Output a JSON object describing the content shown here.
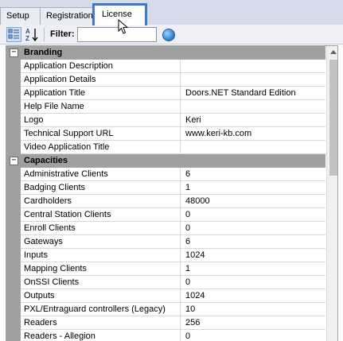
{
  "tabs": [
    {
      "label": "Setup"
    },
    {
      "label": "Registration"
    },
    {
      "label": "License"
    }
  ],
  "active_tab": "License",
  "toolbar": {
    "filter_label": "Filter:",
    "filter_value": ""
  },
  "grid": {
    "categories": [
      {
        "label": "Branding",
        "toggle": "−",
        "rows": [
          {
            "name": "Application Description",
            "value": ""
          },
          {
            "name": "Application Details",
            "value": ""
          },
          {
            "name": "Application Title",
            "value": "Doors.NET Standard Edition"
          },
          {
            "name": "Help File Name",
            "value": ""
          },
          {
            "name": "Logo",
            "value": "Keri"
          },
          {
            "name": "Technical Support URL",
            "value": "www.keri-kb.com"
          },
          {
            "name": "Video Application Title",
            "value": ""
          }
        ]
      },
      {
        "label": "Capacities",
        "toggle": "−",
        "rows": [
          {
            "name": "Administrative Clients",
            "value": "6"
          },
          {
            "name": "Badging Clients",
            "value": "1"
          },
          {
            "name": "Cardholders",
            "value": "48000"
          },
          {
            "name": "Central Station Clients",
            "value": "0"
          },
          {
            "name": "Enroll Clients",
            "value": "0"
          },
          {
            "name": "Gateways",
            "value": "6"
          },
          {
            "name": "Inputs",
            "value": "1024"
          },
          {
            "name": "Mapping Clients",
            "value": "1"
          },
          {
            "name": "OnSSI Clients",
            "value": "0"
          },
          {
            "name": "Outputs",
            "value": "1024"
          },
          {
            "name": "PXL/Entraguard controllers (Legacy)",
            "value": "10"
          },
          {
            "name": "Readers",
            "value": "256"
          },
          {
            "name": "Readers - Allegion",
            "value": "0"
          }
        ]
      }
    ]
  },
  "icons": {
    "categorized": "categorized-view-icon",
    "alphabetical": "sort-alphabetical-icon",
    "filter_go": "filter-go-icon",
    "cursor": "mouse-pointer-icon"
  },
  "colors": {
    "active_tab_border": "#3f79c9",
    "category_band": "#a0a0a0",
    "tabstrip_bg": "#d6dbe9"
  }
}
